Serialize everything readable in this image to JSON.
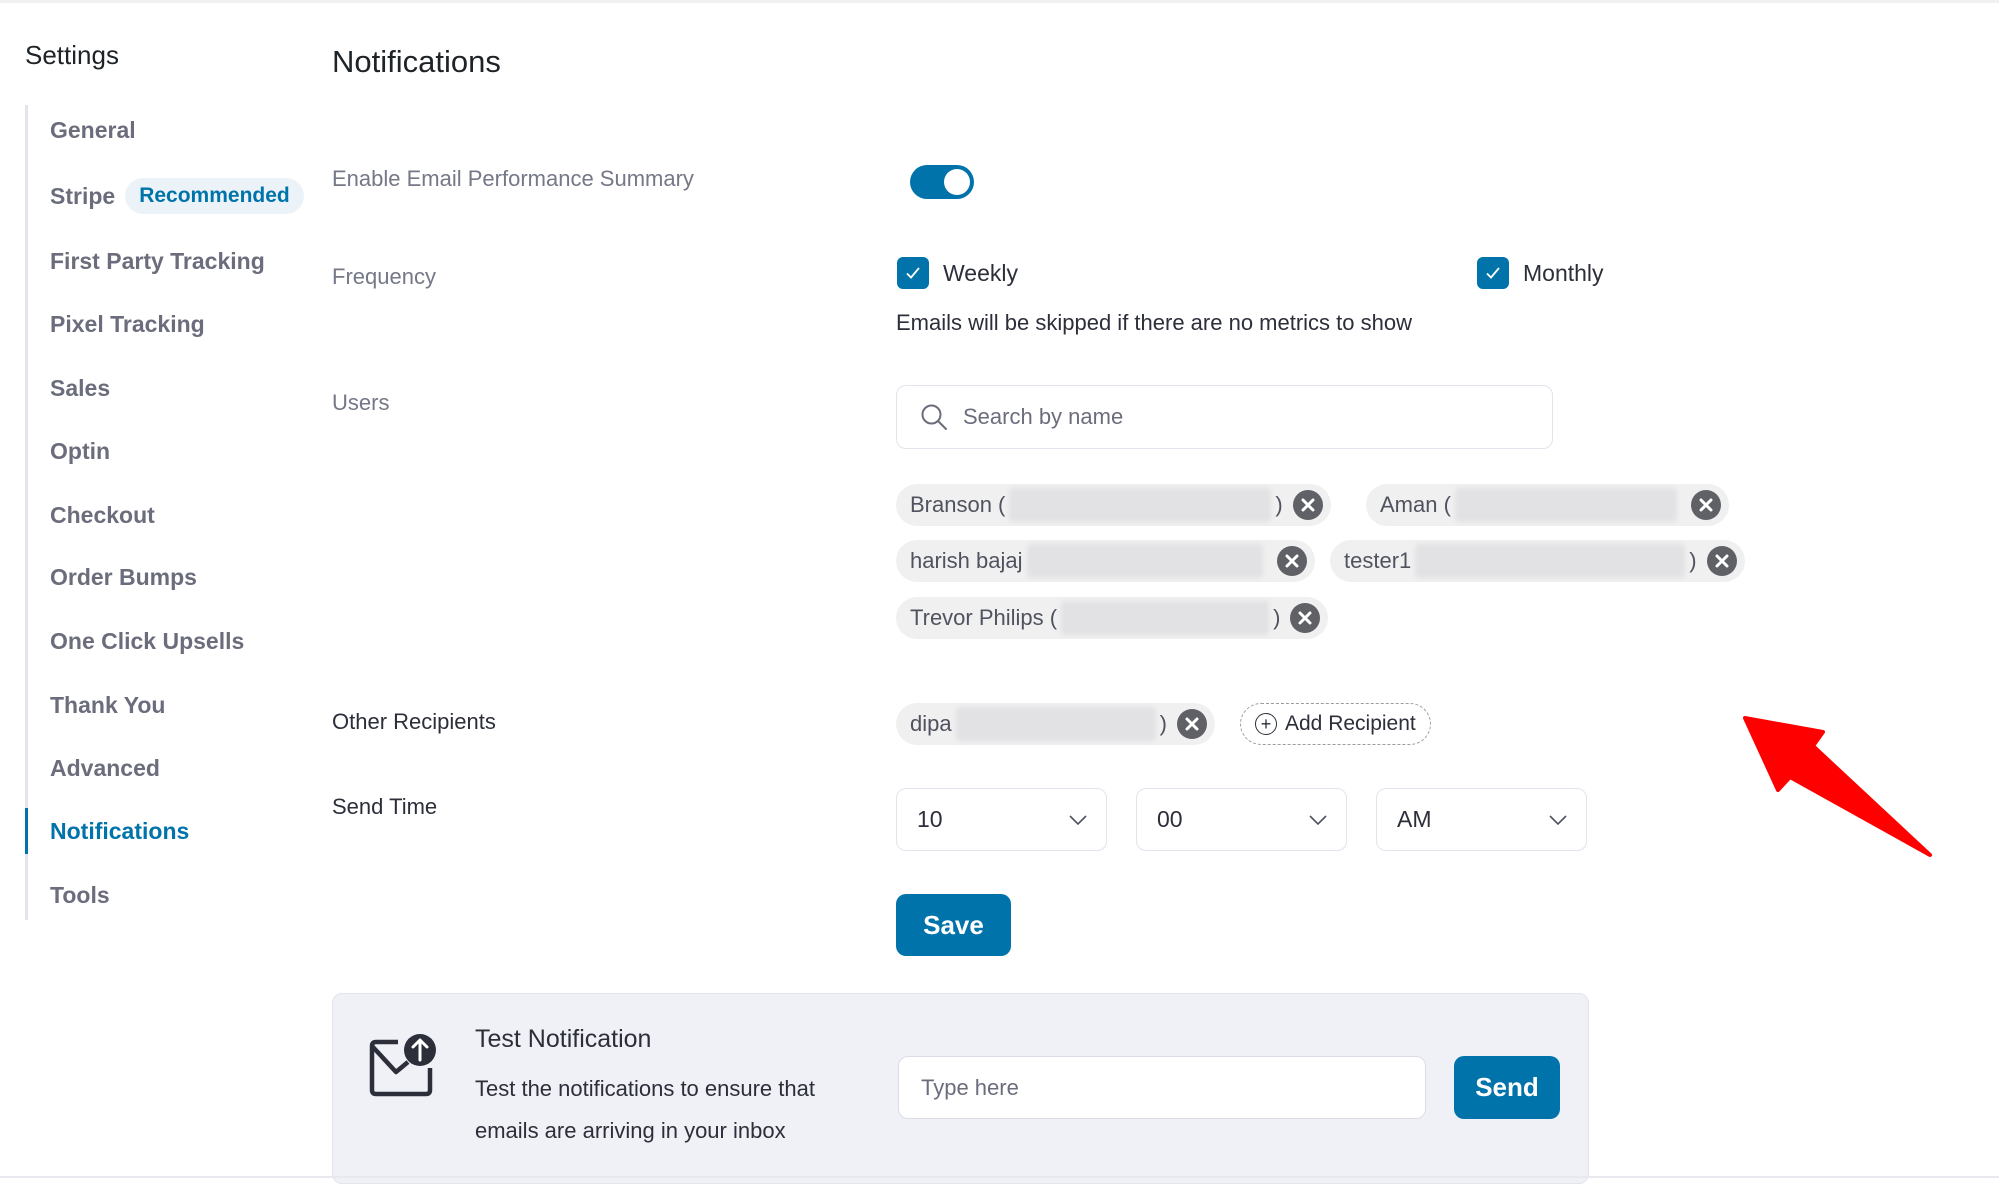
{
  "sidebar": {
    "title": "Settings",
    "items": [
      {
        "label": "General"
      },
      {
        "label": "Stripe",
        "badge": "Recommended"
      },
      {
        "label": "First Party Tracking"
      },
      {
        "label": "Pixel Tracking"
      },
      {
        "label": "Sales"
      },
      {
        "label": "Optin"
      },
      {
        "label": "Checkout"
      },
      {
        "label": "Order Bumps"
      },
      {
        "label": "One Click Upsells"
      },
      {
        "label": "Thank You"
      },
      {
        "label": "Advanced"
      },
      {
        "label": "Notifications",
        "active": true
      },
      {
        "label": "Tools"
      }
    ]
  },
  "main": {
    "title": "Notifications",
    "enable_summary": {
      "label": "Enable Email Performance Summary",
      "enabled": true
    },
    "frequency": {
      "label": "Frequency",
      "options": [
        {
          "label": "Weekly",
          "checked": true
        },
        {
          "label": "Monthly",
          "checked": true
        }
      ],
      "hint": "Emails will be skipped if there are no metrics to show"
    },
    "users": {
      "label": "Users",
      "search_placeholder": "Search by name",
      "chips": [
        {
          "prefix": "Branson ( ",
          "suffix": ")"
        },
        {
          "prefix": "Aman ( ",
          "suffix": ""
        },
        {
          "prefix": "harish bajaj",
          "suffix": ""
        },
        {
          "prefix": "tester1",
          "suffix": ")"
        },
        {
          "prefix": "Trevor Philips ( ",
          "suffix": ")"
        }
      ]
    },
    "other_recipients": {
      "label": "Other Recipients",
      "chips": [
        {
          "prefix": "dipa ",
          "suffix": ")"
        }
      ],
      "add_label": "Add Recipient"
    },
    "send_time": {
      "label": "Send Time",
      "hour": "10",
      "minute": "00",
      "period": "AM"
    },
    "save_label": "Save",
    "test_notification": {
      "title": "Test Notification",
      "description": "Test the notifications to ensure that emails are arriving in your inbox",
      "input_placeholder": "Type here",
      "send_label": "Send"
    }
  },
  "annotation": {
    "type": "arrow",
    "color": "#ff0000"
  }
}
